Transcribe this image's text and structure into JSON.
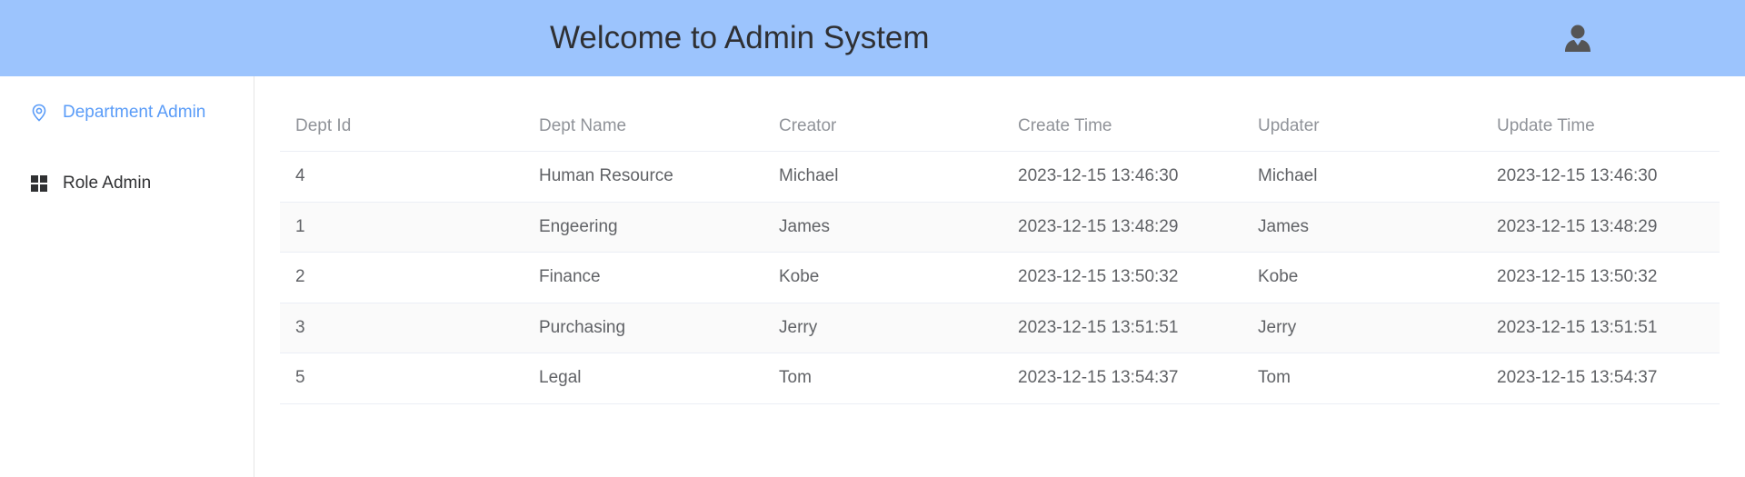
{
  "header": {
    "title": "Welcome to Admin System",
    "user_icon": "user-icon",
    "background": "#9cc4fd"
  },
  "sidebar": {
    "items": [
      {
        "label": "Department Admin",
        "icon": "location-pin-icon",
        "active": true
      },
      {
        "label": "Role Admin",
        "icon": "grid-icon",
        "active": false
      }
    ],
    "active_color": "#5a9cf8"
  },
  "table": {
    "columns": [
      "Dept Id",
      "Dept Name",
      "Creator",
      "Create Time",
      "Updater",
      "Update Time"
    ],
    "rows": [
      [
        "4",
        "Human Resource",
        "Michael",
        "2023-12-15 13:46:30",
        "Michael",
        "2023-12-15 13:46:30"
      ],
      [
        "1",
        "Engeering",
        "James",
        "2023-12-15 13:48:29",
        "James",
        "2023-12-15 13:48:29"
      ],
      [
        "2",
        "Finance",
        "Kobe",
        "2023-12-15 13:50:32",
        "Kobe",
        "2023-12-15 13:50:32"
      ],
      [
        "3",
        "Purchasing",
        "Jerry",
        "2023-12-15 13:51:51",
        "Jerry",
        "2023-12-15 13:51:51"
      ],
      [
        "5",
        "Legal",
        "Tom",
        "2023-12-15 13:54:37",
        "Tom",
        "2023-12-15 13:54:37"
      ]
    ]
  }
}
